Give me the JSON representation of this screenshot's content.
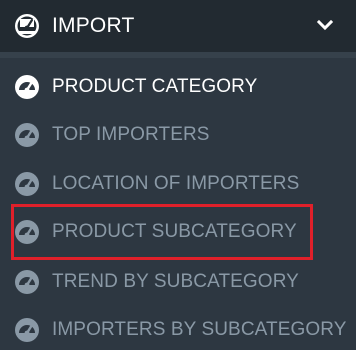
{
  "menu": {
    "header": {
      "label": "IMPORT",
      "icon": "dashboard-icon",
      "toggle_icon": "chevron-down-icon"
    },
    "items": [
      {
        "label": "PRODUCT CATEGORY",
        "state": "active",
        "icon": "dashboard-icon"
      },
      {
        "label": "TOP IMPORTERS",
        "state": "inactive",
        "icon": "dashboard-icon"
      },
      {
        "label": "LOCATION OF IMPORTERS",
        "state": "inactive",
        "icon": "dashboard-icon"
      },
      {
        "label": "PRODUCT SUBCATEGORY",
        "state": "inactive",
        "icon": "dashboard-icon",
        "highlighted": true
      },
      {
        "label": "TREND BY SUBCATEGORY",
        "state": "inactive",
        "icon": "dashboard-icon"
      },
      {
        "label": "IMPORTERS BY SUBCATEGORY",
        "state": "inactive",
        "icon": "dashboard-icon"
      }
    ]
  },
  "colors": {
    "background": "#2d3741",
    "header_background": "#222a31",
    "active_text": "#ffffff",
    "inactive_text": "#8a99a6",
    "highlight": "#e0202a"
  }
}
